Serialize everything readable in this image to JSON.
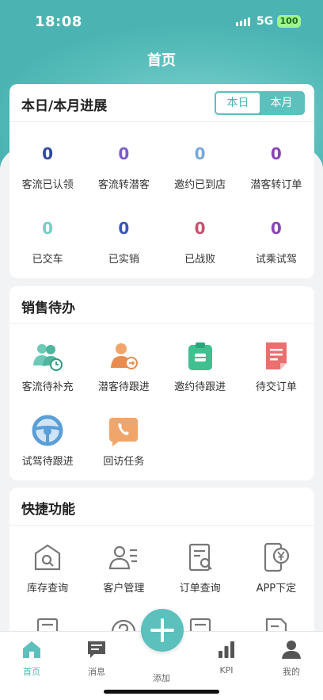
{
  "status_bar": {
    "time": "18:08",
    "network": "5G",
    "battery": "100"
  },
  "header": {
    "title": "首页"
  },
  "progress": {
    "title": "本日/本月进展",
    "toggle": {
      "day": "本日",
      "month": "本月",
      "selected": "本日"
    },
    "stats": [
      {
        "value": "0",
        "label": "客流已认领",
        "color": "#2d4aa0"
      },
      {
        "value": "0",
        "label": "客流转潜客",
        "color": "#7b5ccc"
      },
      {
        "value": "0",
        "label": "邀约已到店",
        "color": "#78a8d8"
      },
      {
        "value": "0",
        "label": "潜客转订单",
        "color": "#8b44b8"
      },
      {
        "value": "0",
        "label": "已交车",
        "color": "#6fd0c8"
      },
      {
        "value": "0",
        "label": "已实销",
        "color": "#3a56b8"
      },
      {
        "value": "0",
        "label": "已战败",
        "color": "#c8506e"
      },
      {
        "value": "0",
        "label": "试乘试驾",
        "color": "#8b44b8"
      }
    ]
  },
  "sales_todo": {
    "title": "销售待办",
    "items": [
      {
        "label": "客流待补充",
        "icon": "people-clock-icon"
      },
      {
        "label": "潜客待跟进",
        "icon": "person-arrow-icon"
      },
      {
        "label": "邀约待跟进",
        "icon": "clipboard-icon"
      },
      {
        "label": "待交订单",
        "icon": "document-icon"
      },
      {
        "label": "试驾待跟进",
        "icon": "steering-wheel-icon"
      },
      {
        "label": "回访任务",
        "icon": "phone-icon"
      }
    ]
  },
  "quick_functions": {
    "title": "快捷功能",
    "items": [
      {
        "label": "库存查询",
        "icon": "warehouse-search-icon"
      },
      {
        "label": "客户管理",
        "icon": "customer-list-icon"
      },
      {
        "label": "订单查询",
        "icon": "order-search-icon"
      },
      {
        "label": "APP下定",
        "icon": "app-yen-icon"
      }
    ]
  },
  "tabbar": {
    "items": [
      {
        "label": "首页",
        "icon": "home-icon",
        "active": true
      },
      {
        "label": "消息",
        "icon": "message-icon",
        "active": false
      },
      {
        "label": "添加",
        "icon": "add-icon",
        "active": false
      },
      {
        "label": "KPI",
        "icon": "bar-chart-icon",
        "active": false
      },
      {
        "label": "我的",
        "icon": "profile-icon",
        "active": false
      }
    ]
  },
  "colors": {
    "accent": "#5cc0bd",
    "accent_dark": "#4bb4b2"
  }
}
